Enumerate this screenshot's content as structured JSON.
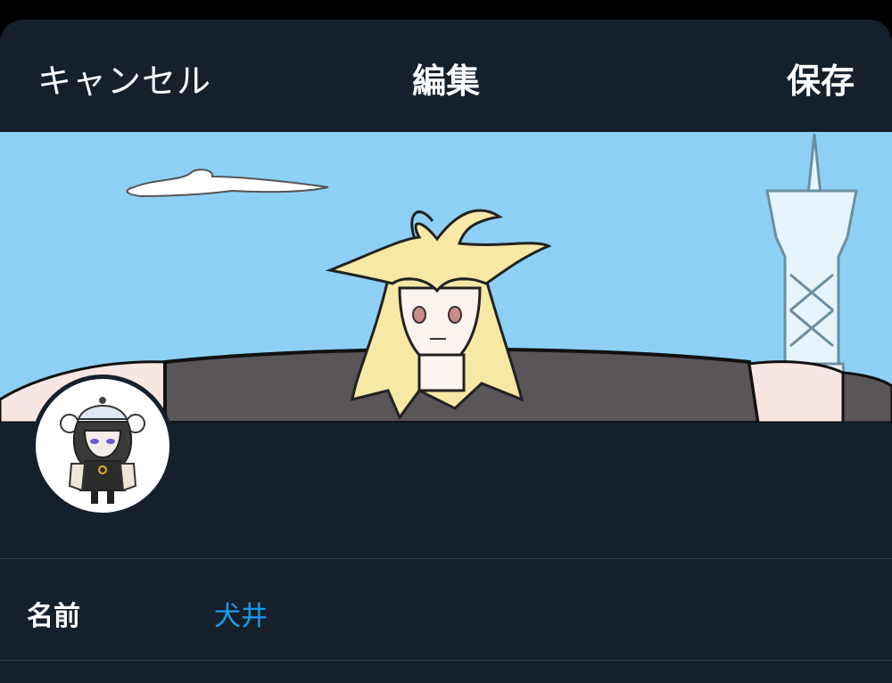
{
  "nav": {
    "cancel_label": "キャンセル",
    "title": "編集",
    "save_label": "保存"
  },
  "profile": {
    "header_image": "header-illustration",
    "avatar_image": "avatar-illustration"
  },
  "fields": {
    "name_label": "名前",
    "name_value": "犬井"
  },
  "colors": {
    "background": "#15202b",
    "accent": "#1d9bf0",
    "sky": "#8ed0f5",
    "divider": "#2f3b47"
  }
}
